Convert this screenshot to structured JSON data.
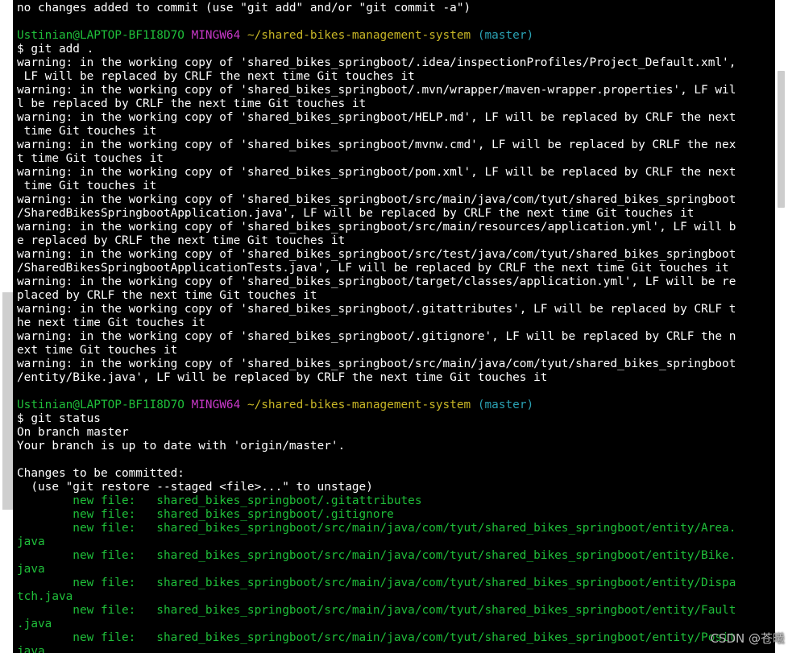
{
  "terminal": {
    "lines": [
      {
        "cls": "",
        "segments": [
          {
            "text": "no changes added to commit (use \"git add\" and/or \"git commit -a\")",
            "color": ""
          }
        ]
      },
      {
        "cls": "",
        "segments": [
          {
            "text": "",
            "color": ""
          }
        ]
      },
      {
        "cls": "prompt",
        "segments": [
          {
            "text": "Ustinian@LAPTOP-BF1I8D7O",
            "color": "green"
          },
          {
            "text": " ",
            "color": ""
          },
          {
            "text": "MINGW64",
            "color": "magenta"
          },
          {
            "text": " ",
            "color": ""
          },
          {
            "text": "~/shared-bikes-management-system",
            "color": "yellow"
          },
          {
            "text": " ",
            "color": ""
          },
          {
            "text": "(master)",
            "color": "cyan"
          }
        ]
      },
      {
        "cls": "",
        "segments": [
          {
            "text": "$ git add .",
            "color": ""
          }
        ]
      },
      {
        "cls": "",
        "segments": [
          {
            "text": "warning: in the working copy of 'shared_bikes_springboot/.idea/inspectionProfiles/Project_Default.xml',",
            "color": ""
          }
        ]
      },
      {
        "cls": "",
        "segments": [
          {
            "text": " LF will be replaced by CRLF the next time Git touches it",
            "color": ""
          }
        ]
      },
      {
        "cls": "",
        "segments": [
          {
            "text": "warning: in the working copy of 'shared_bikes_springboot/.mvn/wrapper/maven-wrapper.properties', LF wil",
            "color": ""
          }
        ]
      },
      {
        "cls": "",
        "segments": [
          {
            "text": "l be replaced by CRLF the next time Git touches it",
            "color": ""
          }
        ]
      },
      {
        "cls": "",
        "segments": [
          {
            "text": "warning: in the working copy of 'shared_bikes_springboot/HELP.md', LF will be replaced by CRLF the next",
            "color": ""
          }
        ]
      },
      {
        "cls": "",
        "segments": [
          {
            "text": " time Git touches it",
            "color": ""
          }
        ]
      },
      {
        "cls": "",
        "segments": [
          {
            "text": "warning: in the working copy of 'shared_bikes_springboot/mvnw.cmd', LF will be replaced by CRLF the nex",
            "color": ""
          }
        ]
      },
      {
        "cls": "",
        "segments": [
          {
            "text": "t time Git touches it",
            "color": ""
          }
        ]
      },
      {
        "cls": "",
        "segments": [
          {
            "text": "warning: in the working copy of 'shared_bikes_springboot/pom.xml', LF will be replaced by CRLF the next",
            "color": ""
          }
        ]
      },
      {
        "cls": "",
        "segments": [
          {
            "text": " time Git touches it",
            "color": ""
          }
        ]
      },
      {
        "cls": "",
        "segments": [
          {
            "text": "warning: in the working copy of 'shared_bikes_springboot/src/main/java/com/tyut/shared_bikes_springboot",
            "color": ""
          }
        ]
      },
      {
        "cls": "",
        "segments": [
          {
            "text": "/SharedBikesSpringbootApplication.java', LF will be replaced by CRLF the next time Git touches it",
            "color": ""
          }
        ]
      },
      {
        "cls": "",
        "segments": [
          {
            "text": "warning: in the working copy of 'shared_bikes_springboot/src/main/resources/application.yml', LF will b",
            "color": ""
          }
        ]
      },
      {
        "cls": "",
        "segments": [
          {
            "text": "e replaced by CRLF the next time Git touches it",
            "color": ""
          }
        ]
      },
      {
        "cls": "",
        "segments": [
          {
            "text": "warning: in the working copy of 'shared_bikes_springboot/src/test/java/com/tyut/shared_bikes_springboot",
            "color": ""
          }
        ]
      },
      {
        "cls": "",
        "segments": [
          {
            "text": "/SharedBikesSpringbootApplicationTests.java', LF will be replaced by CRLF the next time Git touches it",
            "color": ""
          }
        ]
      },
      {
        "cls": "",
        "segments": [
          {
            "text": "warning: in the working copy of 'shared_bikes_springboot/target/classes/application.yml', LF will be re",
            "color": ""
          }
        ]
      },
      {
        "cls": "",
        "segments": [
          {
            "text": "placed by CRLF the next time Git touches it",
            "color": ""
          }
        ]
      },
      {
        "cls": "",
        "segments": [
          {
            "text": "warning: in the working copy of 'shared_bikes_springboot/.gitattributes', LF will be replaced by CRLF t",
            "color": ""
          }
        ]
      },
      {
        "cls": "",
        "segments": [
          {
            "text": "he next time Git touches it",
            "color": ""
          }
        ]
      },
      {
        "cls": "",
        "segments": [
          {
            "text": "warning: in the working copy of 'shared_bikes_springboot/.gitignore', LF will be replaced by CRLF the n",
            "color": ""
          }
        ]
      },
      {
        "cls": "",
        "segments": [
          {
            "text": "ext time Git touches it",
            "color": ""
          }
        ]
      },
      {
        "cls": "",
        "segments": [
          {
            "text": "warning: in the working copy of 'shared_bikes_springboot/src/main/java/com/tyut/shared_bikes_springboot",
            "color": ""
          }
        ]
      },
      {
        "cls": "",
        "segments": [
          {
            "text": "/entity/Bike.java', LF will be replaced by CRLF the next time Git touches it",
            "color": ""
          }
        ]
      },
      {
        "cls": "",
        "segments": [
          {
            "text": "",
            "color": ""
          }
        ]
      },
      {
        "cls": "prompt",
        "segments": [
          {
            "text": "Ustinian@LAPTOP-BF1I8D7O",
            "color": "green"
          },
          {
            "text": " ",
            "color": ""
          },
          {
            "text": "MINGW64",
            "color": "magenta"
          },
          {
            "text": " ",
            "color": ""
          },
          {
            "text": "~/shared-bikes-management-system",
            "color": "yellow"
          },
          {
            "text": " ",
            "color": ""
          },
          {
            "text": "(master)",
            "color": "cyan"
          }
        ]
      },
      {
        "cls": "",
        "segments": [
          {
            "text": "$ git status",
            "color": ""
          }
        ]
      },
      {
        "cls": "",
        "segments": [
          {
            "text": "On branch master",
            "color": ""
          }
        ]
      },
      {
        "cls": "",
        "segments": [
          {
            "text": "Your branch is up to date with 'origin/master'.",
            "color": ""
          }
        ]
      },
      {
        "cls": "",
        "segments": [
          {
            "text": "",
            "color": ""
          }
        ]
      },
      {
        "cls": "",
        "segments": [
          {
            "text": "Changes to be committed:",
            "color": ""
          }
        ]
      },
      {
        "cls": "",
        "segments": [
          {
            "text": "  (use \"git restore --staged <file>...\" to unstage)",
            "color": ""
          }
        ]
      },
      {
        "cls": "",
        "segments": [
          {
            "text": "        new file:   shared_bikes_springboot/.gitattributes",
            "color": "green"
          }
        ]
      },
      {
        "cls": "",
        "segments": [
          {
            "text": "        new file:   shared_bikes_springboot/.gitignore",
            "color": "green"
          }
        ]
      },
      {
        "cls": "",
        "segments": [
          {
            "text": "        new file:   shared_bikes_springboot/src/main/java/com/tyut/shared_bikes_springboot/entity/Area.",
            "color": "green"
          }
        ]
      },
      {
        "cls": "",
        "segments": [
          {
            "text": "java",
            "color": "green"
          }
        ]
      },
      {
        "cls": "",
        "segments": [
          {
            "text": "        new file:   shared_bikes_springboot/src/main/java/com/tyut/shared_bikes_springboot/entity/Bike.",
            "color": "green"
          }
        ]
      },
      {
        "cls": "",
        "segments": [
          {
            "text": "java",
            "color": "green"
          }
        ]
      },
      {
        "cls": "",
        "segments": [
          {
            "text": "        new file:   shared_bikes_springboot/src/main/java/com/tyut/shared_bikes_springboot/entity/Dispa",
            "color": "green"
          }
        ]
      },
      {
        "cls": "",
        "segments": [
          {
            "text": "tch.java",
            "color": "green"
          }
        ]
      },
      {
        "cls": "",
        "segments": [
          {
            "text": "        new file:   shared_bikes_springboot/src/main/java/com/tyut/shared_bikes_springboot/entity/Fault",
            "color": "green"
          }
        ]
      },
      {
        "cls": "",
        "segments": [
          {
            "text": ".java",
            "color": "green"
          }
        ]
      },
      {
        "cls": "",
        "segments": [
          {
            "text": "        new file:   shared_bikes_springboot/src/main/java/com/tyut/shared_bikes_springboot/entity/Posit",
            "color": "green"
          }
        ]
      },
      {
        "cls": "",
        "segments": [
          {
            "text": "java",
            "color": "green"
          }
        ]
      }
    ]
  },
  "watermark": "CSDN @苍曦",
  "colors": {
    "background": "#000000",
    "text": "#ffffff",
    "green": "#1fbf3a",
    "magenta": "#c838c8",
    "yellow": "#c8b626",
    "cyan": "#2aa1b3"
  }
}
